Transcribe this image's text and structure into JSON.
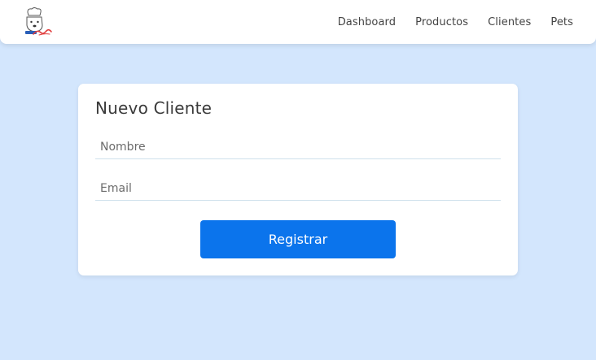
{
  "navbar": {
    "logo_icon": "dog-chef-logo-icon",
    "links": [
      {
        "label": "Dashboard"
      },
      {
        "label": "Productos"
      },
      {
        "label": "Clientes"
      },
      {
        "label": "Pets"
      }
    ]
  },
  "form": {
    "title": "Nuevo Cliente",
    "name_placeholder": "Nombre",
    "name_value": "",
    "email_placeholder": "Email",
    "email_value": "",
    "submit_label": "Registrar"
  },
  "colors": {
    "background": "#d3e6fd",
    "primary": "#0b74ec",
    "card": "#ffffff"
  }
}
